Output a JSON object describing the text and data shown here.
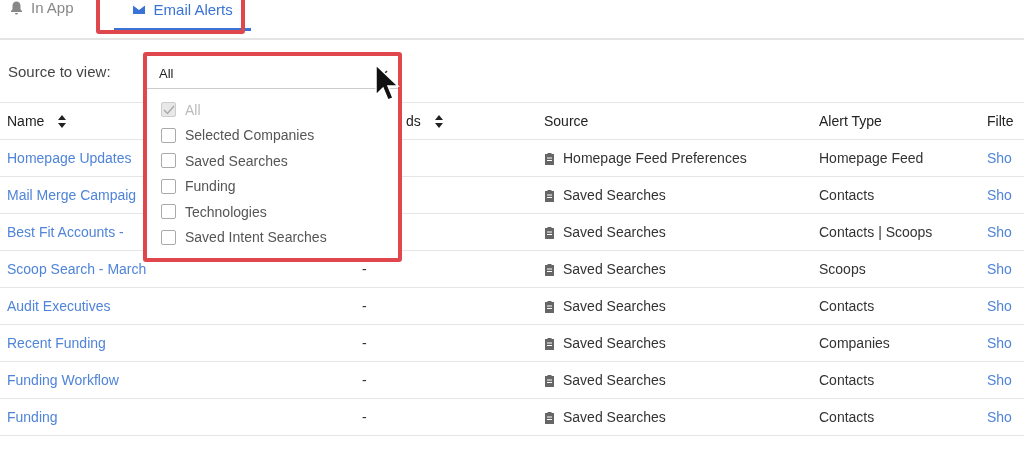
{
  "tabs": [
    {
      "label": "In App",
      "kind": "bell",
      "selected": false
    },
    {
      "label": "Email Alerts",
      "kind": "mail",
      "selected": true
    }
  ],
  "filter": {
    "label": "Source to view:",
    "value": "All",
    "options": [
      {
        "label": "All",
        "checked": true,
        "disabled": true
      },
      {
        "label": "Selected Companies",
        "checked": false,
        "disabled": false
      },
      {
        "label": "Saved Searches",
        "checked": false,
        "disabled": false
      },
      {
        "label": "Funding",
        "checked": false,
        "disabled": false
      },
      {
        "label": "Technologies",
        "checked": false,
        "disabled": false
      },
      {
        "label": "Saved Intent Searches",
        "checked": false,
        "disabled": false
      }
    ]
  },
  "table": {
    "columns": [
      {
        "label": "Name",
        "sortable": true
      },
      {
        "label": "ds",
        "sortable": true
      },
      {
        "label": "Source",
        "sortable": false
      },
      {
        "label": "Alert Type",
        "sortable": false
      },
      {
        "label": "Filte",
        "sortable": false
      }
    ],
    "rows": [
      {
        "name": "Homepage Updates",
        "source": "Homepage Feed Preferences",
        "alert_type": "Homepage Feed",
        "filters": "Sho"
      },
      {
        "name": "Mail Merge Campaig",
        "source": "Saved Searches",
        "alert_type": "Contacts",
        "filters": "Sho"
      },
      {
        "name": "Best Fit Accounts -",
        "source": "Saved Searches",
        "alert_type": "Contacts | Scoops",
        "filters": "Sho"
      },
      {
        "name": "Scoop Search - March",
        "column_2": "-",
        "source": "Saved Searches",
        "alert_type": "Scoops",
        "filters": "Sho"
      },
      {
        "name": "Audit Executives",
        "column_2": "-",
        "source": "Saved Searches",
        "alert_type": "Contacts",
        "filters": "Sho"
      },
      {
        "name": "Recent Funding",
        "column_2": "-",
        "source": "Saved Searches",
        "alert_type": "Companies",
        "filters": "Sho"
      },
      {
        "name": "Funding Workflow",
        "column_2": "-",
        "source": "Saved Searches",
        "alert_type": "Contacts",
        "filters": "Sho"
      },
      {
        "name": "Funding",
        "column_2": "-",
        "source": "Saved Searches",
        "alert_type": "Contacts",
        "filters": "Sho"
      }
    ]
  }
}
